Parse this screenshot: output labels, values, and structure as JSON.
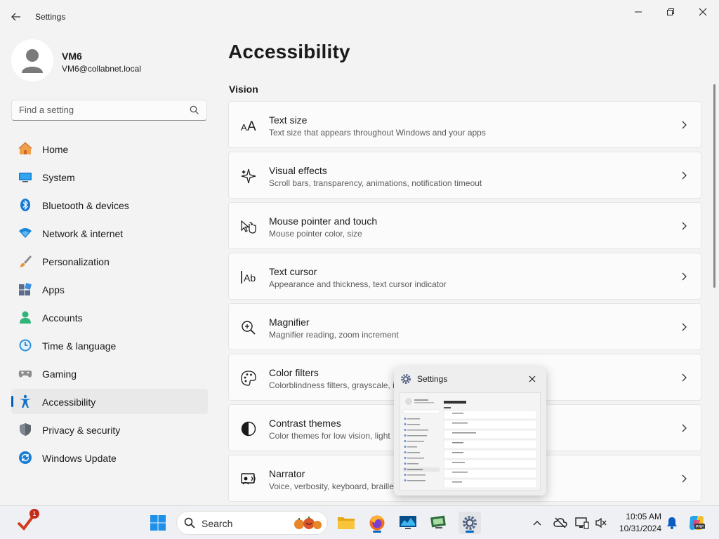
{
  "window": {
    "title": "Settings",
    "controls": [
      "minimize",
      "maximize",
      "close"
    ]
  },
  "user": {
    "name": "VM6",
    "email": "VM6@collabnet.local"
  },
  "search": {
    "placeholder": "Find a setting"
  },
  "nav": {
    "items": [
      {
        "label": "Home",
        "icon": "home-icon"
      },
      {
        "label": "System",
        "icon": "system-icon"
      },
      {
        "label": "Bluetooth & devices",
        "icon": "bluetooth-icon"
      },
      {
        "label": "Network & internet",
        "icon": "network-icon"
      },
      {
        "label": "Personalization",
        "icon": "brush-icon"
      },
      {
        "label": "Apps",
        "icon": "apps-icon"
      },
      {
        "label": "Accounts",
        "icon": "accounts-icon"
      },
      {
        "label": "Time & language",
        "icon": "clock-globe-icon"
      },
      {
        "label": "Gaming",
        "icon": "gamepad-icon"
      },
      {
        "label": "Accessibility",
        "icon": "accessibility-icon",
        "active": true
      },
      {
        "label": "Privacy & security",
        "icon": "shield-icon"
      },
      {
        "label": "Windows Update",
        "icon": "update-icon"
      }
    ]
  },
  "main": {
    "title": "Accessibility",
    "section": "Vision",
    "cards": [
      {
        "title": "Text size",
        "desc": "Text size that appears throughout Windows and your apps",
        "icon": "text-size-icon"
      },
      {
        "title": "Visual effects",
        "desc": "Scroll bars, transparency, animations, notification timeout",
        "icon": "sparkle-icon"
      },
      {
        "title": "Mouse pointer and touch",
        "desc": "Mouse pointer color, size",
        "icon": "pointer-hand-icon"
      },
      {
        "title": "Text cursor",
        "desc": "Appearance and thickness, text cursor indicator",
        "icon": "text-cursor-icon"
      },
      {
        "title": "Magnifier",
        "desc": "Magnifier reading, zoom increment",
        "icon": "magnifier-icon"
      },
      {
        "title": "Color filters",
        "desc": "Colorblindness filters, grayscale, i",
        "icon": "palette-icon"
      },
      {
        "title": "Contrast themes",
        "desc": "Color themes for low vision, light",
        "icon": "contrast-icon"
      },
      {
        "title": "Narrator",
        "desc": "Voice, verbosity, keyboard, braille",
        "icon": "narrator-icon"
      }
    ]
  },
  "thumbnail": {
    "title": "Settings"
  },
  "taskbar": {
    "search_label": "Search",
    "notification_count": "1",
    "time": "10:05 AM",
    "date": "10/31/2024",
    "accent": "#0067c0"
  }
}
